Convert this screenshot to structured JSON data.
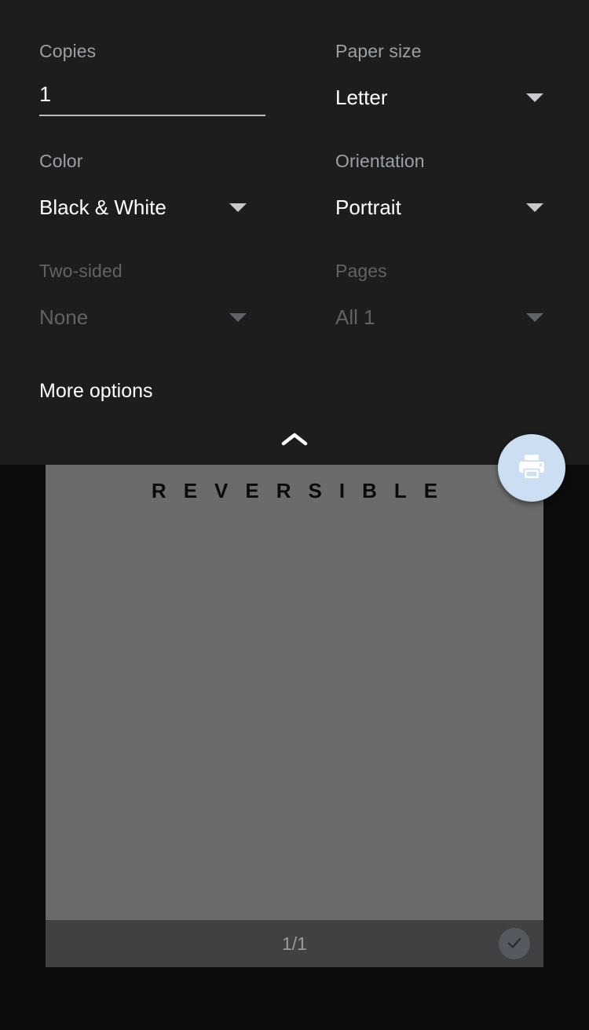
{
  "panel": {
    "copies": {
      "label": "Copies",
      "value": "1",
      "placeholder": "1"
    },
    "paper_size": {
      "label": "Paper size",
      "value": "Letter",
      "caret_icon": "chevron-down-icon"
    },
    "color": {
      "label": "Color",
      "value": "Black & White",
      "caret_icon": "chevron-down-icon"
    },
    "orientation": {
      "label": "Orientation",
      "value": "Portrait",
      "caret_icon": "chevron-down-icon"
    },
    "two_sided": {
      "label": "Two-sided",
      "value": "None",
      "caret_icon": "chevron-down-icon",
      "disabled": true
    },
    "pages": {
      "label": "Pages",
      "value": "All 1",
      "caret_icon": "chevron-down-icon",
      "disabled": true
    },
    "more_options_label": "More options",
    "collapse_icon": "chevron-up-icon"
  },
  "print_button": {
    "icon": "printer-icon",
    "accent_color": "#ccdef2",
    "icon_color": "#ffffff"
  },
  "preview": {
    "document_title": "REVERSIBLE",
    "page_counter": "1/1",
    "select_icon": "check-circle-icon",
    "page_color": "#6b6b6b",
    "toolbar_color": "#414141"
  },
  "theme": {
    "panel_bg": "#1d1d1d",
    "screen_bg": "#0c0c0c",
    "label_color": "#9aa0a6",
    "value_color": "#ffffff",
    "disabled_color": "#5f6368"
  }
}
